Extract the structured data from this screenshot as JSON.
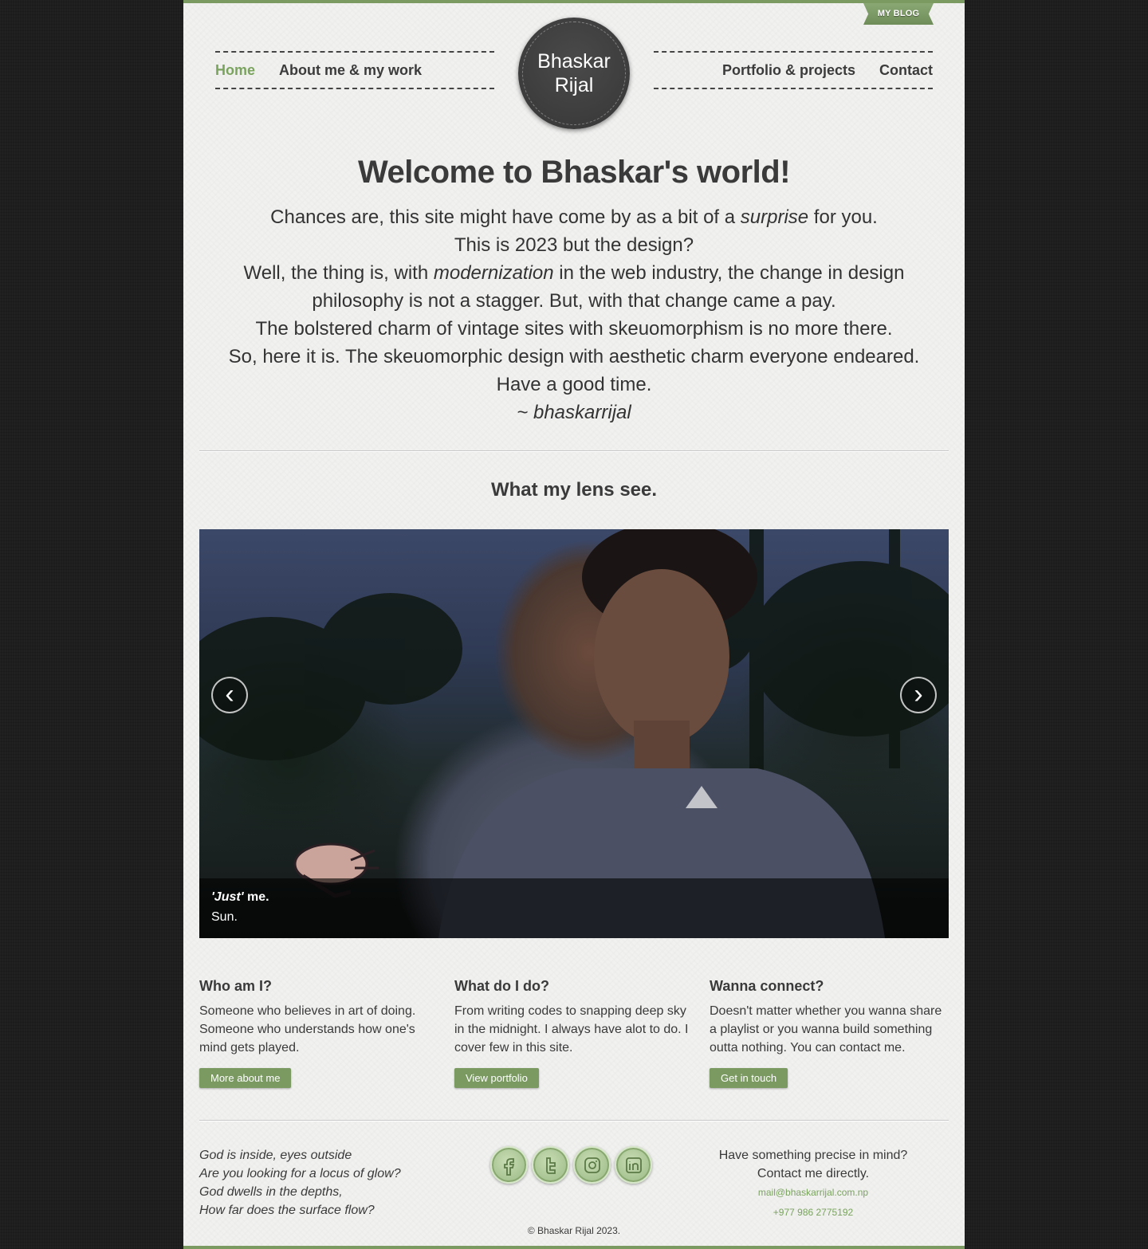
{
  "ribbon": {
    "label": "MY BLOG"
  },
  "nav": {
    "left": [
      {
        "label": "Home",
        "active": true
      },
      {
        "label": "About me & my work",
        "active": false
      }
    ],
    "right": [
      {
        "label": "Portfolio & projects",
        "active": false
      },
      {
        "label": "Contact",
        "active": false
      }
    ],
    "logo": "Bhaskar Rijal"
  },
  "welcome": {
    "title": "Welcome to Bhaskar's world!",
    "line1_a": "Chances are, this site might have come by as a bit of a ",
    "line1_em": "surprise",
    "line1_b": " for you.",
    "line2": "This is 2023 but the design?",
    "line3_a": "Well, the thing is, with ",
    "line3_em": "modernization",
    "line3_b": " in the web industry, the change in design philosophy is not a stagger. But, with that change came a pay.",
    "line4": "The bolstered charm of vintage sites with skeuomorphism is no more there.",
    "line5": "So, here it is. The skeuomorphic design with aesthetic charm everyone endeared.",
    "line6": "Have a good time.",
    "signature": "~ bhaskarrijal"
  },
  "lens": {
    "title": "What my lens see.",
    "prev": "‹",
    "next": "›",
    "caption_em": "'Just'",
    "caption_title_rest": " me.",
    "caption_text": "Sun."
  },
  "columns": [
    {
      "title": "Who am I?",
      "text": "Someone who believes in art of doing. Someone who understands how one's mind gets played.",
      "button": "More about me"
    },
    {
      "title": "What do I do?",
      "text": "From writing codes to snapping deep sky in the midnight. I always have alot to do. I cover few in this site.",
      "button": "View portfolio"
    },
    {
      "title": "Wanna connect?",
      "text": "Doesn't matter whether you wanna share a playlist or you wanna build something outta nothing. You can contact me.",
      "button": "Get in touch"
    }
  ],
  "footer": {
    "poem": [
      "God is inside, eyes outside",
      "Are you looking for a locus of glow?",
      "God dwells in the depths,",
      "How far does the surface flow?"
    ],
    "socials": [
      "facebook-icon",
      "twitter-icon",
      "instagram-icon",
      "linkedin-icon"
    ],
    "copyright": "© Bhaskar Rijal 2023.",
    "contact_line1": "Have something precise in mind?",
    "contact_line2": "Contact me directly.",
    "email": "mail@bhaskarrijal.com.np",
    "phone": "+977 986 2775192"
  },
  "colors": {
    "accent": "#7a9a62",
    "link_active": "#7aa35e",
    "background": "#1e1e1e",
    "page": "#f1f1f0",
    "logo_bg": "#3d3d3d"
  }
}
